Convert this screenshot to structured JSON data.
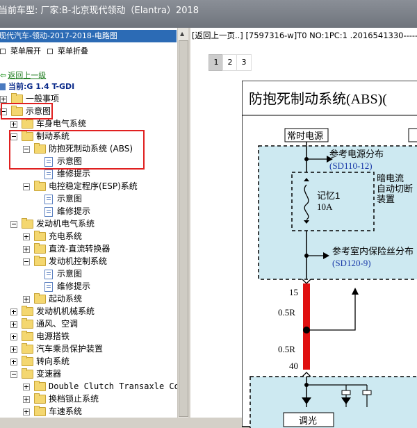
{
  "window": {
    "title": "当前车型:  厂家:B-北京现代领动（Elantra）2018"
  },
  "left_panel": {
    "header": "现代汽车-领动-2017-2018-电路图",
    "menu": {
      "expand": "菜单展开",
      "collapse": "菜单折叠"
    },
    "back_link": "返回上一级",
    "current": "当前:G 1.4 T-GDI",
    "tree": [
      {
        "label": "一般事项"
      },
      {
        "label": "示意图"
      },
      {
        "label": "车身电气系统"
      },
      {
        "label": "制动系统"
      },
      {
        "label": "防抱死制动系统 (ABS)"
      },
      {
        "label": "示意图"
      },
      {
        "label": "维修提示"
      },
      {
        "label": "电控稳定程序(ESP)系统"
      },
      {
        "label": "示意图"
      },
      {
        "label": "维修提示"
      },
      {
        "label": "发动机电气系统"
      },
      {
        "label": "充电系统"
      },
      {
        "label": "直流-直流转换器"
      },
      {
        "label": "发动机控制系统"
      },
      {
        "label": "示意图"
      },
      {
        "label": "维修提示"
      },
      {
        "label": "起动系统"
      },
      {
        "label": "发动机机械系统"
      },
      {
        "label": "通风、空调"
      },
      {
        "label": "电源搭铁"
      },
      {
        "label": "汽车乘员保护装置"
      },
      {
        "label": "转向系统"
      },
      {
        "label": "变速器"
      },
      {
        "label": "Double Clutch Transaxle Cor"
      },
      {
        "label": "换档锁止系统"
      },
      {
        "label": "车速系统"
      }
    ]
  },
  "right_panel": {
    "info_line": "[返回上一页..] [7597316-w]T0 NO:1PC:1 .2016541330-----..",
    "pages": [
      "1",
      "2",
      "3"
    ],
    "active_page": "1",
    "diagram": {
      "title": "防抱死制动系统(ABS)(",
      "power_label": "常时电源",
      "ref1": "参考电源分布",
      "ref1_code": "(SD110-12)",
      "fuse_name": "记忆1",
      "fuse_amp": "10A",
      "dark_current": "暗电流",
      "auto_cut": "自动切断",
      "device": "装置",
      "ref2": "参考室内保险丝分布",
      "ref2_code": "(SD120-9)",
      "pin_top": "15",
      "wire1": "0.5R",
      "wire2": "0.5R",
      "pin_bottom": "40",
      "bottom_text": "调光"
    }
  },
  "colors": {
    "wire_red": "#e01010",
    "box_fill": "#cde9f1",
    "ref_blue": "#1a3aa8"
  }
}
